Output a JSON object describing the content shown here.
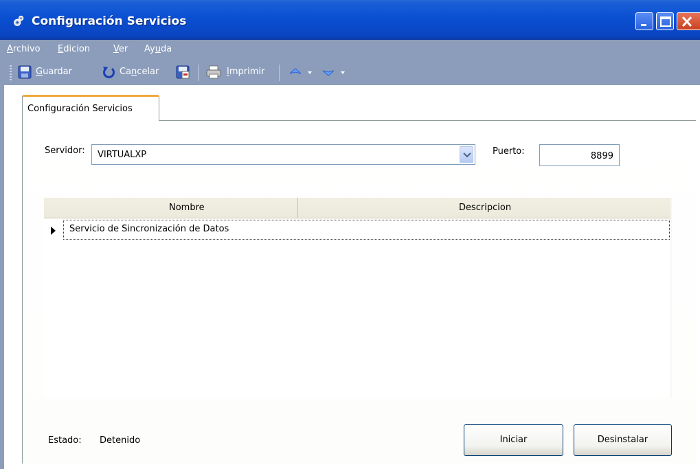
{
  "window": {
    "title": "Configuración Servicios"
  },
  "menu": {
    "items": [
      {
        "first": "A",
        "rest": "rchivo"
      },
      {
        "first": "E",
        "rest": "dicion"
      },
      {
        "first": "V",
        "rest": "er"
      },
      {
        "pre": "Ay",
        "first": "u",
        "rest": "da"
      }
    ]
  },
  "toolbar": {
    "guardar": {
      "first": "G",
      "rest": "uardar"
    },
    "cancelar": {
      "pre": "Ca",
      "first": "n",
      "rest": "celar"
    },
    "imprimir": {
      "first": "I",
      "rest": "mprimir"
    }
  },
  "tab": {
    "label": "Configuración Servicios"
  },
  "form": {
    "servidor_label": "Servidor:",
    "servidor_value": "VIRTUALXP",
    "puerto_label": "Puerto:",
    "puerto_value": "8899"
  },
  "grid": {
    "columns": [
      "Nombre",
      "Descripcion"
    ],
    "rows": [
      {
        "nombre": "Servicio de Sincronización de Datos",
        "descripcion": ""
      }
    ]
  },
  "status": {
    "label": "Estado:",
    "value": "Detenido"
  },
  "buttons": {
    "iniciar": "Iniciar",
    "desinstalar": "Desinstalar"
  }
}
